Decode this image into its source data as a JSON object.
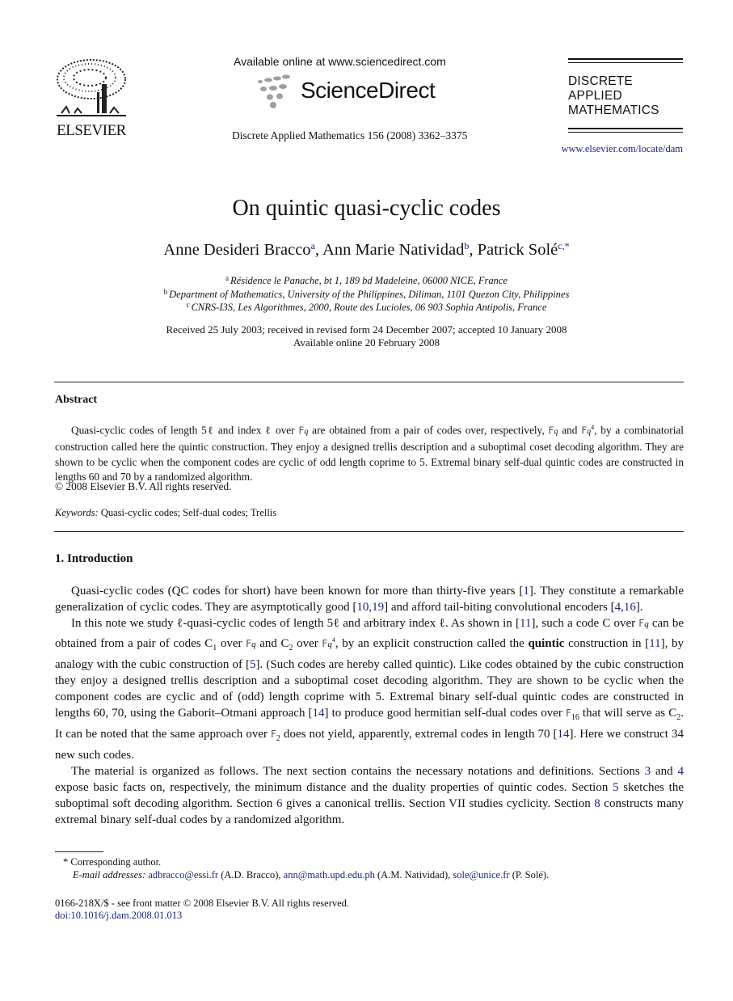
{
  "header": {
    "publisher": "ELSEVIER",
    "available_online": "Available online at www.sciencedirect.com",
    "sciencedirect_logo": "ScienceDirect",
    "journal_citation": "Discrete Applied Mathematics 156 (2008) 3362–3375",
    "journal_title_lines": [
      "DISCRETE",
      "APPLIED",
      "MATHEMATICS"
    ],
    "journal_url": "www.elsevier.com/locate/dam"
  },
  "article": {
    "title": "On quintic quasi-cyclic codes",
    "authors": [
      {
        "name": "Anne Desideri Bracco",
        "mark": "a"
      },
      {
        "name": "Ann Marie Natividad",
        "mark": "b"
      },
      {
        "name": "Patrick Solé",
        "mark": "c,*"
      }
    ],
    "affiliations": [
      {
        "mark": "a",
        "text": "Résidence le Panache, bt 1, 189 bd Madeleine, 06000 NICE, France"
      },
      {
        "mark": "b",
        "text": "Department of Mathematics, University of the Philippines, Diliman, 1101 Quezon City, Philippines"
      },
      {
        "mark": "c",
        "text": "CNRS-I3S, Les Algorithmes, 2000, Route des Lucioles, 06 903 Sophia Antipolis, France"
      }
    ],
    "dates": "Received 25 July 2003; received in revised form 24 December 2007; accepted 10 January 2008",
    "available_online": "Available online 20 February 2008"
  },
  "abstract": {
    "heading": "Abstract",
    "text_parts": [
      "Quasi-cyclic codes of length 5ℓ and index ℓ over ",
      " are obtained from a pair of codes over, respectively, ",
      " and ",
      ", by a combinatorial construction called here the quintic construction. They enjoy a designed trellis description and a suboptimal coset decoding algorithm. They are shown to be cyclic when the component codes are cyclic of odd length coprime to 5. Extremal binary self-dual quintic codes are constructed in lengths 60 and 70 by a randomized algorithm."
    ],
    "copyright": "© 2008 Elsevier B.V. All rights reserved.",
    "keywords_label": "Keywords:",
    "keywords": "Quasi-cyclic codes; Self-dual codes; Trellis"
  },
  "introduction": {
    "heading": "1.  Introduction",
    "p1": [
      "Quasi-cyclic codes (QC codes for short) have been known for more than thirty-five years [",
      "1",
      "]. They constitute a remarkable generalization of cyclic codes. They are asymptotically good [",
      "10,19",
      "] and afford tail-biting convolutional encoders [",
      "4,16",
      "]."
    ],
    "p2": [
      "In this note we study ℓ-quasi-cyclic codes of length 5ℓ and arbitrary index ℓ. As shown in [",
      "11",
      "], such a code C over ",
      " can be obtained from a pair of codes C",
      "1",
      " over ",
      " and C",
      "2",
      " over ",
      ", by an explicit construction called the ",
      "quintic",
      " construction in [",
      "11",
      "], by analogy with the cubic construction of [",
      "5",
      "]. (Such codes are hereby called quintic). Like codes obtained by the cubic construction they enjoy a designed trellis description and a suboptimal coset decoding algorithm. They are shown to be cyclic when the component codes are cyclic and of (odd) length coprime with 5. Extremal binary self-dual quintic codes are constructed in lengths 60, 70, using the Gaborit–Otmani approach [",
      "14",
      "] to produce good hermitian self-dual codes over ",
      " that will serve as C",
      "2",
      ". It can be noted that the same approach over ",
      " does not yield, apparently, extremal codes in length 70 [",
      "14",
      "]. Here we construct 34 new such codes."
    ],
    "p3": [
      "The material is organized as follows. The next section contains the necessary notations and definitions. Sections ",
      "3",
      " and ",
      "4",
      " expose basic facts on, respectively, the minimum distance and the duality properties of quintic codes. Section ",
      "5",
      " sketches the suboptimal soft decoding algorithm. Section ",
      "6",
      " gives a canonical trellis. Section VII studies cyclicity. Section ",
      "8",
      " constructs many extremal binary self-dual codes by a randomized algorithm."
    ]
  },
  "math": {
    "Fq": "F",
    "q": "q",
    "q4_exp": "4",
    "F16_sub": "16",
    "F2_sub": "2"
  },
  "footnotes": {
    "corresponding": "* Corresponding author.",
    "email_label": "E-mail addresses:",
    "emails": [
      {
        "address": "adbracco@essi.fr",
        "who": " (A.D. Bracco), "
      },
      {
        "address": "ann@math.upd.edu.ph",
        "who": " (A.M. Natividad), "
      },
      {
        "address": "sole@unice.fr",
        "who": " (P. Solé)."
      }
    ],
    "issn": "0166-218X/$ - see front matter © 2008 Elsevier B.V. All rights reserved.",
    "doi": "doi:10.1016/j.dam.2008.01.013"
  },
  "colors": {
    "link": "#1a237e",
    "text": "#111111",
    "logo_gray": "#9e9e9e"
  }
}
